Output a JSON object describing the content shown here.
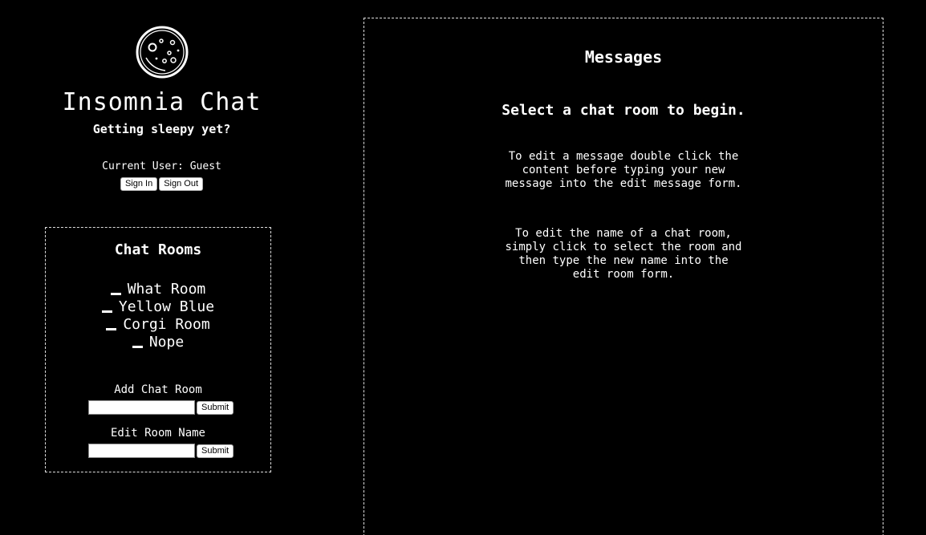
{
  "app": {
    "title": "Insomnia Chat",
    "tagline": "Getting sleepy yet?",
    "logo_icon": "moon-icon"
  },
  "user": {
    "current_user_text": "Current User: Guest",
    "sign_in_label": "Sign In",
    "sign_out_label": "Sign Out"
  },
  "rooms": {
    "heading": "Chat Rooms",
    "items": [
      {
        "label": "What Room"
      },
      {
        "label": "Yellow Blue"
      },
      {
        "label": "Corgi Room"
      },
      {
        "label": "Nope"
      }
    ],
    "add_label": "Add Chat Room",
    "add_value": "",
    "add_submit": "Submit",
    "edit_label": "Edit Room Name",
    "edit_value": "",
    "edit_submit": "Submit"
  },
  "messages": {
    "heading": "Messages",
    "prompt": "Select a chat room to begin.",
    "help_edit_message": "To edit a message double click the content before typing your new message into the edit message form.",
    "help_edit_room": "To edit the name of a chat room, simply click to select the room and then type the new name into the edit room form."
  },
  "colors": {
    "background": "#000000",
    "foreground": "#ffffff",
    "border": "#dddddd"
  }
}
